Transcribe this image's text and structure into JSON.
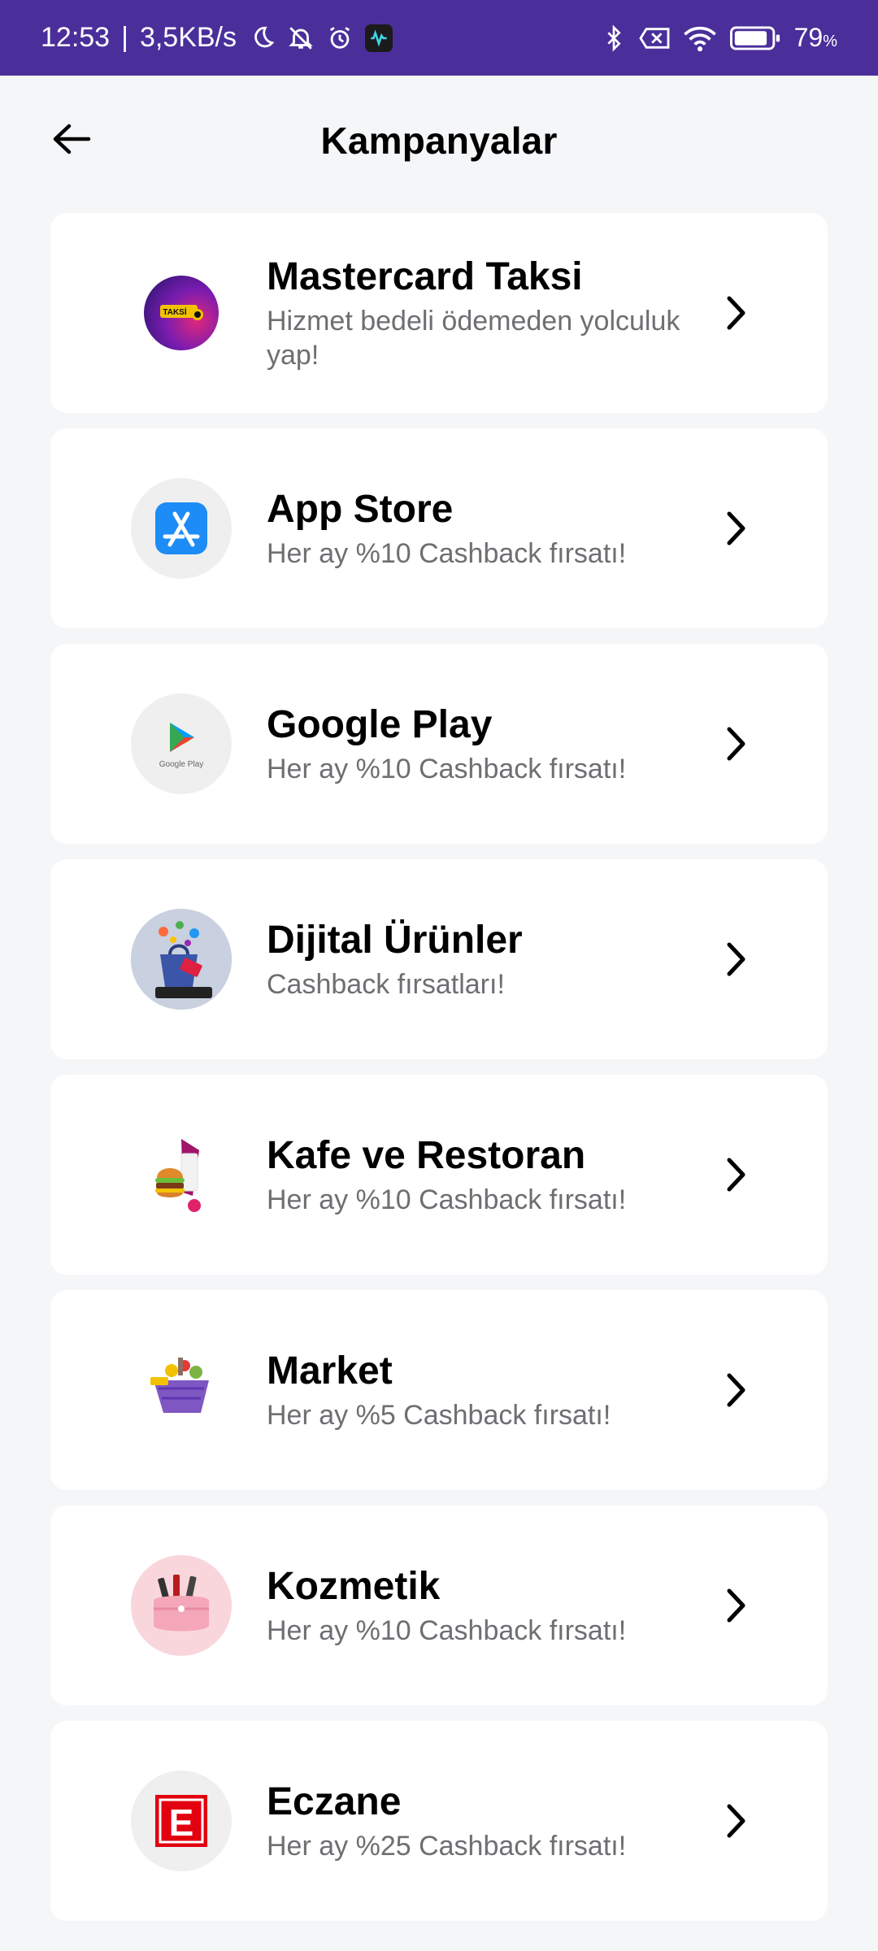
{
  "status_bar": {
    "time": "12:53",
    "network_speed": "3,5KB/s",
    "battery_percent": "79",
    "battery_unit": "%"
  },
  "header": {
    "title": "Kampanyalar"
  },
  "campaigns": [
    {
      "title": "Mastercard Taksi",
      "subtitle": "Hizmet bedeli ödemeden yolculuk yap!",
      "logo_icon": "taksi-logo-icon",
      "logo_text": "TAKSİ"
    },
    {
      "title": "App Store",
      "subtitle": "Her ay %10 Cashback fırsatı!",
      "logo_icon": "app-store-icon"
    },
    {
      "title": "Google Play",
      "subtitle": "Her ay %10 Cashback fırsatı!",
      "logo_icon": "google-play-icon",
      "logo_text": "Google Play"
    },
    {
      "title": "Dijital Ürünler",
      "subtitle": "Cashback fırsatları!",
      "logo_icon": "digital-products-icon"
    },
    {
      "title": "Kafe ve Restoran",
      "subtitle": "Her ay %10 Cashback fırsatı!",
      "logo_icon": "burger-icon"
    },
    {
      "title": "Market",
      "subtitle": "Her ay %5 Cashback fırsatı!",
      "logo_icon": "grocery-basket-icon"
    },
    {
      "title": "Kozmetik",
      "subtitle": "Her ay %10 Cashback fırsatı!",
      "logo_icon": "cosmetics-bag-icon"
    },
    {
      "title": "Eczane",
      "subtitle": "Her ay %25 Cashback fırsatı!",
      "logo_icon": "pharmacy-e-icon",
      "logo_text": "E"
    }
  ],
  "colors": {
    "status_bar_bg": "#4a2f9b",
    "page_bg": "#f5f6f8",
    "card_bg": "#ffffff",
    "subtitle": "#6e6e73"
  }
}
